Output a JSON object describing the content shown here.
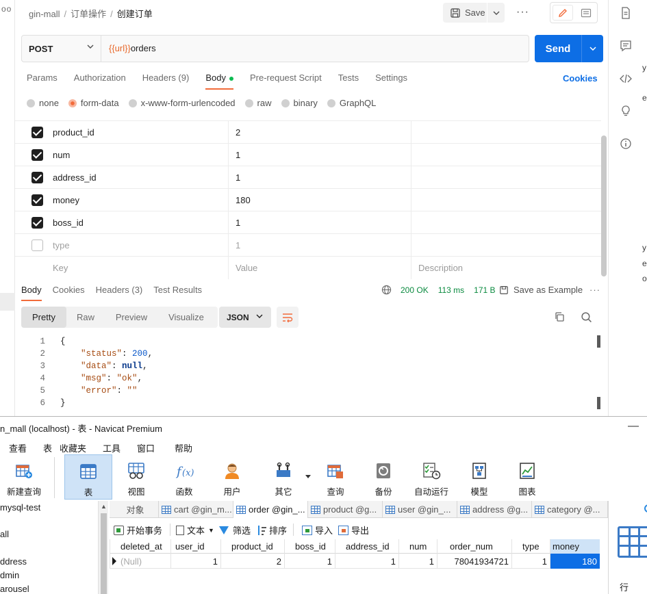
{
  "postman": {
    "breadcrumb": {
      "collection": "gin-mall",
      "folder": "订单操作",
      "request": "创建订单"
    },
    "save_label": "Save",
    "request": {
      "method": "POST",
      "url_var": "{{url}}",
      "url_path": "orders",
      "send_label": "Send"
    },
    "req_tabs": [
      {
        "label": "Params"
      },
      {
        "label": "Authorization"
      },
      {
        "label": "Headers (9)"
      },
      {
        "label": "Body"
      },
      {
        "label": "Pre-request Script"
      },
      {
        "label": "Tests"
      },
      {
        "label": "Settings"
      }
    ],
    "cookies_label": "Cookies",
    "body_types": [
      "none",
      "form-data",
      "x-www-form-urlencoded",
      "raw",
      "binary",
      "GraphQL"
    ],
    "form_rows": [
      {
        "key": "product_id",
        "value": "2",
        "checked": true
      },
      {
        "key": "num",
        "value": "1",
        "checked": true
      },
      {
        "key": "address_id",
        "value": "1",
        "checked": true
      },
      {
        "key": "money",
        "value": "180",
        "checked": true
      },
      {
        "key": "boss_id",
        "value": "1",
        "checked": true
      },
      {
        "key": "type",
        "value": "1",
        "checked": false
      }
    ],
    "placeholders": {
      "key": "Key",
      "value": "Value",
      "description": "Description"
    },
    "resp_tabs": [
      "Body",
      "Cookies",
      "Headers (3)",
      "Test Results"
    ],
    "resp_meta": {
      "status": "200 OK",
      "time": "113 ms",
      "size": "171 B"
    },
    "save_example_label": "Save as Example",
    "view_tabs": [
      "Pretty",
      "Raw",
      "Preview",
      "Visualize"
    ],
    "format": "JSON",
    "code_lines": [
      {
        "n": "1",
        "html": "{"
      },
      {
        "n": "2",
        "html": "    <span class=\"jk\">\"status\"</span>: <span class=\"jn\">200</span>,"
      },
      {
        "n": "3",
        "html": "    <span class=\"jk\">\"data\"</span>: <span class=\"jnull\">null</span>,"
      },
      {
        "n": "4",
        "html": "    <span class=\"jk\">\"msg\"</span>: <span class=\"js\">\"ok\"</span>,"
      },
      {
        "n": "5",
        "html": "    <span class=\"jk\">\"error\"</span>: <span class=\"js\">\"\"</span>"
      },
      {
        "n": "6",
        "html": "}"
      }
    ],
    "peek_chars": [
      "y",
      "e",
      "y",
      "e",
      "o"
    ]
  },
  "navicat": {
    "title": "n_mall (localhost) - 表 - Navicat Premium",
    "menu": [
      "查看",
      "表",
      "收藏夹",
      "工具",
      "窗口",
      "帮助"
    ],
    "tools": [
      "新建查询",
      "表",
      "视图",
      "函数",
      "用户",
      "其它",
      "查询",
      "备份",
      "自动运行",
      "模型",
      "图表"
    ],
    "tree": [
      "mysql-test",
      "all",
      "ddress",
      "dmin",
      "arousel"
    ],
    "obj_tabs": [
      "对象",
      "cart @gin_m...",
      "order @gin_...",
      "product @g...",
      "user @gin_...",
      "address @g...",
      "category @..."
    ],
    "actions": [
      "开始事务",
      "文本",
      "筛选",
      "排序",
      "导入",
      "导出"
    ],
    "columns": [
      "deleted_at",
      "user_id",
      "product_id",
      "boss_id",
      "address_id",
      "num",
      "order_num",
      "type",
      "money"
    ],
    "rows": [
      [
        "(Null)",
        "1",
        "2",
        "1",
        "1",
        "1",
        "78041934721",
        "1",
        "180"
      ]
    ],
    "info_label": "行"
  }
}
